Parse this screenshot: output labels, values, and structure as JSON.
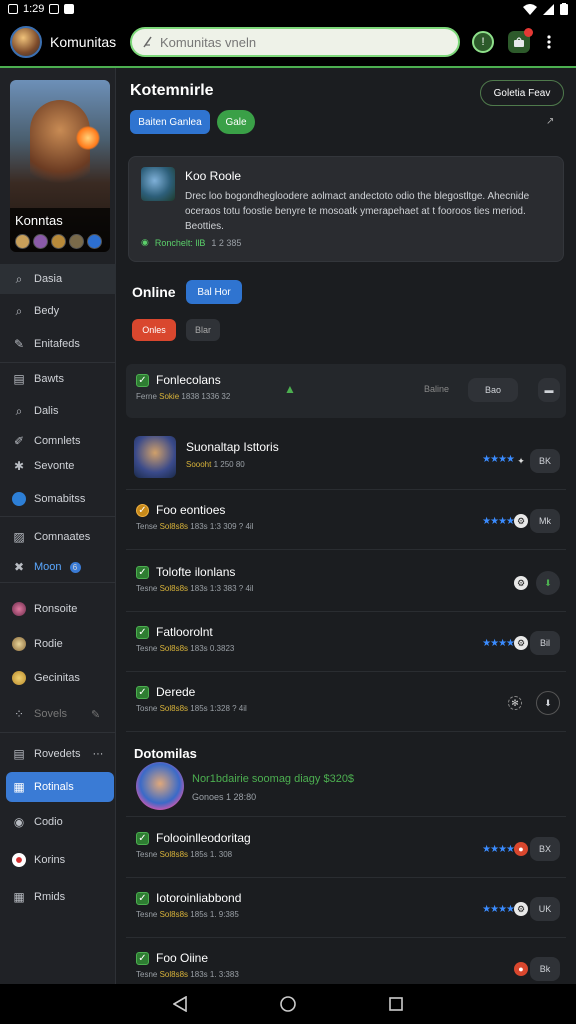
{
  "status_bar": {
    "time": "1:29",
    "icons": [
      "notification-icon",
      "wifi-icon",
      "signal-icon",
      "battery-icon"
    ]
  },
  "top_bar": {
    "app_title": "Komunitas",
    "search_placeholder": "Komunitas vneln",
    "chat_icon_label": "!",
    "bag_badge": "•"
  },
  "sidebar": {
    "game_title": "Konntas",
    "items": [
      {
        "label": "Dasia",
        "icon": "search-icon"
      },
      {
        "label": "Bedy",
        "icon": "search-icon"
      },
      {
        "label": "Enitafeds",
        "icon": "brush-icon"
      },
      {
        "label": "Bawts",
        "icon": "inbox-icon"
      },
      {
        "label": "Dalis",
        "icon": "search-icon"
      },
      {
        "label": "Comnlets",
        "icon": "pencil-icon"
      },
      {
        "label": "Sevonte",
        "icon": "puzzle-icon"
      },
      {
        "label": "Somabitss",
        "icon": "globe-icon"
      },
      {
        "label": "Comnaates",
        "icon": "edit-icon"
      },
      {
        "label": "Moon",
        "icon": "puzzle-icon",
        "badge": "6"
      },
      {
        "label": "Ronsoite",
        "icon": "avatar-icon"
      },
      {
        "label": "Rodie",
        "icon": "avatar-icon"
      },
      {
        "label": "Gecinitas",
        "icon": "avatar-icon"
      },
      {
        "label": "Sovels",
        "icon": "dots-icon"
      },
      {
        "label": "Rovedets",
        "icon": "inbox-icon"
      },
      {
        "label": "Rotinals",
        "icon": "calendar-icon"
      },
      {
        "label": "Codio",
        "icon": "pin-icon"
      },
      {
        "label": "Korins",
        "icon": "record-icon"
      },
      {
        "label": "Rmids",
        "icon": "grid-icon"
      }
    ]
  },
  "main": {
    "title": "Kotemnirle",
    "header_button": "Goletia Feav",
    "tab_primary": "Baiten Ganlea",
    "tab_secondary": "Gale",
    "share_icon": "↗",
    "hero": {
      "title": "Koo Roole",
      "description": "Drec loo bogondhegloodere aolmact andectoto odio the blegostltge. Ahecnide oceraos totu foostie benyre te mosoatk ymerapehaet at t fooroos  ties meriod. Beotties.",
      "meta_status": "Ronchelt: llB",
      "meta_count": "1 2 385"
    },
    "online_title": "Online",
    "online_button": "Bal Hor",
    "filter_red": "Onles",
    "filter_gray": "Blar",
    "rows_top": [
      {
        "name": "Fonlecolans",
        "meta_a": "Ferne",
        "meta_b": "Sokie",
        "meta_c": "1838 1336 32",
        "right_text": "Baline",
        "right_btn": "Bao"
      },
      {
        "name": "Suonaltap Isttoris",
        "meta_a": "Soooht",
        "meta_b": "1 250 80",
        "stars": "★★★★",
        "right_btn": "BK"
      },
      {
        "name": "Foo eontioes",
        "meta_a": "Tense",
        "meta_b": "Sol8s8s",
        "meta_c": "183s 1:3 309 ? 4il",
        "stars": "★★★★",
        "right_btn": "Mk"
      },
      {
        "name": "Tolofte ilonlans",
        "meta_a": "Tesne",
        "meta_b": "Sol8s8s",
        "meta_c": "183s 1:3 383 ? 4il",
        "right_btn": ""
      },
      {
        "name": "Fatloorolnt",
        "meta_a": "Tesne",
        "meta_b": "Sol8s8s",
        "meta_c": "183s 0.3823",
        "stars": "★★★★",
        "right_btn": "Bil"
      },
      {
        "name": "Derede",
        "meta_a": "Tosne",
        "meta_b": "Sol8s8s",
        "meta_c": "185s 1:328 ? 4il",
        "right_btn": ""
      }
    ],
    "section2_title": "Dotomilas",
    "featured": {
      "highlight": "Nor1bdairie soomag diagy $320$",
      "meta_a": "Gonoes",
      "meta_b": "1 28:80"
    },
    "rows_bottom": [
      {
        "name": "Folooinlleodoritag",
        "meta_a": "Tesne",
        "meta_b": "Sol8s8s",
        "meta_c": "185s 1. 308",
        "stars": "★★★★",
        "right_btn": "BX"
      },
      {
        "name": "Iotoroinliabbond",
        "meta_a": "Tesne",
        "meta_b": "Sol8s8s",
        "meta_c": "185s 1. 9:385",
        "stars": "★★★★",
        "right_btn": "UK"
      },
      {
        "name": "Foo Oiine",
        "meta_a": "Tesne",
        "meta_b": "Sol8s8s",
        "meta_c": "183s 1. 3:383",
        "right_btn": "Bk"
      }
    ]
  },
  "colors": {
    "accent_green": "#4caf50",
    "accent_blue": "#3a7bd5",
    "star_blue": "#3b8cff",
    "accent_red": "#d9472e"
  }
}
